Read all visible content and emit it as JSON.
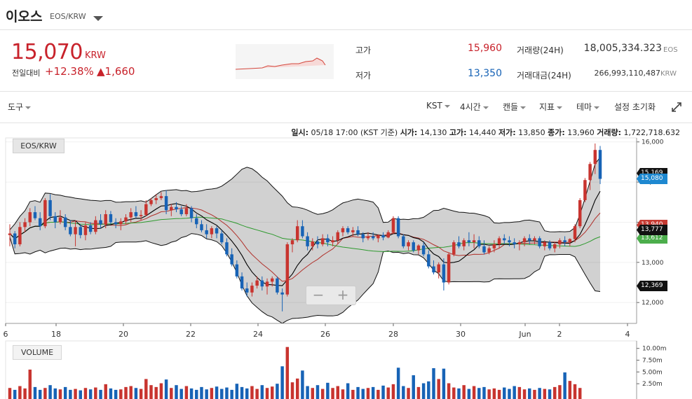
{
  "header": {
    "name": "이오스",
    "pair": "EOS/KRW"
  },
  "price": {
    "current": "15,070",
    "unit": "KRW",
    "change_label": "전일대비",
    "change_pct": "+12.38%",
    "change_amt": "▲1,660"
  },
  "stats": {
    "high_label": "고가",
    "high_value": "15,960",
    "low_label": "저가",
    "low_value": "13,350",
    "volume_label": "거래량(24H)",
    "volume_value": "18,005,334.323",
    "volume_unit": "EOS",
    "amount_label": "거래대금(24H)",
    "amount_value": "266,993,110,487",
    "amount_unit": "KRW"
  },
  "toolbar": {
    "tools": "도구",
    "timezone": "KST",
    "interval": "4시간",
    "chart_type": "캔들",
    "indicators": "지표",
    "theme": "테마",
    "reset": "설정 초기화"
  },
  "ohlc_info": {
    "date_label": "일시:",
    "date_value": "05/18 17:00 (KST 기준)",
    "open_label": "시가:",
    "open_value": "14,130",
    "high_label": "고가:",
    "high_value": "14,440",
    "low_label": "저가:",
    "low_value": "13,850",
    "close_label": "종가:",
    "close_value": "13,960",
    "volume_label": "거래량:",
    "volume_value": "1,722,718.632"
  },
  "chart_labels": {
    "pair_tag": "EOS/KRW",
    "volume_tag": "VOLUME",
    "zoom_out": "−",
    "zoom_in": "+"
  },
  "price_tags": {
    "current": "15,080",
    "upper_hidden": "15,169",
    "ma1": "13,940",
    "ma2": "13,777",
    "ma3": "13,612",
    "lower": "12,369"
  },
  "colors": {
    "up": "#c8342f",
    "down": "#1763b6",
    "ma_short": "#000000",
    "ma_mid": "#b0302a",
    "ma_long": "#2e9a2e",
    "band_fill": "#d1d1d1"
  },
  "chart_data": {
    "type": "candlestick",
    "x_ticks": [
      "6",
      "18",
      "20",
      "22",
      "24",
      "26",
      "28",
      "30",
      "Jun",
      "2",
      "4"
    ],
    "y_ticks": [
      "16,000",
      "15,000",
      "14,000",
      "13,000",
      "12,000"
    ],
    "y_range": [
      11480,
      16100
    ],
    "volume_ticks": [
      "10.00m",
      "7.50m",
      "5.00m",
      "2.50m"
    ],
    "volume_range": [
      0,
      10700000
    ],
    "candles": [
      [
        13680,
        13950,
        13400,
        13720
      ],
      [
        13720,
        13780,
        13350,
        13450
      ],
      [
        13450,
        14000,
        13400,
        13880
      ],
      [
        13880,
        14100,
        13750,
        14000
      ],
      [
        14000,
        14350,
        13900,
        14250
      ],
      [
        14250,
        14400,
        14050,
        14100
      ],
      [
        14100,
        14250,
        13800,
        13900
      ],
      [
        13900,
        14600,
        13850,
        14550
      ],
      [
        14550,
        14700,
        14050,
        14150
      ],
      [
        14150,
        14250,
        13850,
        14000
      ],
      [
        14000,
        14300,
        13950,
        14120
      ],
      [
        14120,
        14200,
        13800,
        13880
      ],
      [
        13880,
        14050,
        13650,
        13700
      ],
      [
        13700,
        14050,
        13400,
        13880
      ],
      [
        13880,
        13950,
        13600,
        13680
      ],
      [
        13680,
        14000,
        13550,
        13920
      ],
      [
        13920,
        14000,
        13700,
        13760
      ],
      [
        13760,
        14150,
        13700,
        14050
      ],
      [
        14050,
        14200,
        13850,
        13950
      ],
      [
        13950,
        14300,
        13850,
        14200
      ],
      [
        14200,
        14280,
        13950,
        14000
      ],
      [
        14000,
        14100,
        13850,
        13950
      ],
      [
        13950,
        14100,
        13800,
        14020
      ],
      [
        14020,
        14200,
        13950,
        14120
      ],
      [
        14120,
        14350,
        14000,
        14250
      ],
      [
        14250,
        14400,
        14100,
        14150
      ],
      [
        14150,
        14300,
        14050,
        14180
      ],
      [
        14180,
        14550,
        14150,
        14450
      ],
      [
        14450,
        14600,
        14400,
        14550
      ],
      [
        14550,
        14700,
        14450,
        14600
      ],
      [
        14600,
        14750,
        14550,
        14650
      ],
      [
        14650,
        14800,
        14200,
        14300
      ],
      [
        14300,
        14450,
        14150,
        14380
      ],
      [
        14380,
        14500,
        14250,
        14320
      ],
      [
        14320,
        14400,
        14150,
        14200
      ],
      [
        14200,
        14450,
        14150,
        14350
      ],
      [
        14350,
        14400,
        14000,
        14100
      ],
      [
        14100,
        14200,
        13850,
        13950
      ],
      [
        13950,
        14050,
        13750,
        13800
      ],
      [
        13800,
        13950,
        13600,
        13700
      ],
      [
        13700,
        13900,
        13600,
        13850
      ],
      [
        13850,
        13900,
        13600,
        13720
      ],
      [
        13720,
        13800,
        13450,
        13500
      ],
      [
        13500,
        13600,
        13150,
        13200
      ],
      [
        13200,
        13350,
        12900,
        12950
      ],
      [
        12950,
        13050,
        12600,
        12650
      ],
      [
        12650,
        12750,
        12300,
        12350
      ],
      [
        12350,
        12500,
        12150,
        12250
      ],
      [
        12250,
        12500,
        12150,
        12420
      ],
      [
        12420,
        12650,
        12350,
        12550
      ],
      [
        12550,
        12650,
        12300,
        12400
      ],
      [
        12400,
        12600,
        12200,
        12520
      ],
      [
        12520,
        12650,
        12400,
        12600
      ],
      [
        12600,
        12650,
        12200,
        12250
      ],
      [
        12250,
        12350,
        11780,
        12200
      ],
      [
        12200,
        13500,
        12150,
        13450
      ],
      [
        13450,
        13600,
        13250,
        13550
      ],
      [
        13550,
        14050,
        13500,
        13900
      ],
      [
        13900,
        14050,
        13600,
        13650
      ],
      [
        13650,
        13750,
        13300,
        13400
      ],
      [
        13400,
        13600,
        13300,
        13520
      ],
      [
        13520,
        13650,
        13350,
        13450
      ],
      [
        13450,
        13700,
        13400,
        13600
      ],
      [
        13600,
        13700,
        13400,
        13500
      ],
      [
        13500,
        13650,
        13400,
        13550
      ],
      [
        13550,
        13800,
        13450,
        13750
      ],
      [
        13750,
        13900,
        13650,
        13850
      ],
      [
        13850,
        13900,
        13700,
        13750
      ],
      [
        13750,
        13880,
        13650,
        13800
      ],
      [
        13800,
        13900,
        13650,
        13700
      ],
      [
        13700,
        13750,
        13500,
        13600
      ],
      [
        13600,
        13750,
        13550,
        13650
      ],
      [
        13650,
        13750,
        13550,
        13600
      ],
      [
        13600,
        13700,
        13500,
        13680
      ],
      [
        13680,
        13750,
        13550,
        13620
      ],
      [
        13620,
        13800,
        13600,
        13750
      ],
      [
        13750,
        14150,
        13700,
        14100
      ],
      [
        14100,
        14150,
        13600,
        13650
      ],
      [
        13650,
        13700,
        13350,
        13400
      ],
      [
        13400,
        13550,
        13300,
        13500
      ],
      [
        13500,
        13550,
        13250,
        13300
      ],
      [
        13300,
        13450,
        13200,
        13420
      ],
      [
        13420,
        13500,
        13150,
        13200
      ],
      [
        13200,
        13300,
        12850,
        12900
      ],
      [
        12900,
        13050,
        12700,
        12750
      ],
      [
        12750,
        13000,
        12600,
        12950
      ],
      [
        12950,
        13100,
        12300,
        12500
      ],
      [
        12500,
        13250,
        12450,
        13200
      ],
      [
        13200,
        13550,
        13150,
        13500
      ],
      [
        13500,
        13650,
        13350,
        13400
      ],
      [
        13400,
        13600,
        13300,
        13550
      ],
      [
        13550,
        13750,
        13400,
        13500
      ],
      [
        13500,
        13700,
        13350,
        13550
      ],
      [
        13550,
        13650,
        13350,
        13400
      ],
      [
        13400,
        13550,
        13200,
        13250
      ],
      [
        13250,
        13400,
        13200,
        13350
      ],
      [
        13350,
        13550,
        13250,
        13450
      ],
      [
        13450,
        13650,
        13350,
        13600
      ],
      [
        13600,
        13700,
        13450,
        13550
      ],
      [
        13550,
        13650,
        13400,
        13500
      ],
      [
        13500,
        13600,
        13350,
        13450
      ],
      [
        13450,
        13550,
        13300,
        13500
      ],
      [
        13500,
        13650,
        13400,
        13600
      ],
      [
        13600,
        13700,
        13450,
        13550
      ],
      [
        13550,
        13650,
        13450,
        13600
      ],
      [
        13600,
        13650,
        13350,
        13400
      ],
      [
        13400,
        13550,
        13300,
        13500
      ],
      [
        13500,
        13550,
        13300,
        13350
      ],
      [
        13350,
        13500,
        13250,
        13450
      ],
      [
        13450,
        13600,
        13350,
        13550
      ],
      [
        13550,
        13650,
        13400,
        13500
      ],
      [
        13500,
        13600,
        13400,
        13580
      ],
      [
        13580,
        13950,
        13500,
        13900
      ],
      [
        13900,
        14600,
        13850,
        14550
      ],
      [
        14550,
        15100,
        14500,
        15050
      ],
      [
        15050,
        15500,
        14800,
        15450
      ],
      [
        15450,
        15960,
        15200,
        15800
      ],
      [
        15800,
        15900,
        14950,
        15080
      ]
    ],
    "volumes": [
      1.6,
      1.2,
      2.0,
      1.5,
      5.5,
      1.8,
      1.2,
      1.6,
      2.2,
      1.5,
      1.3,
      1.8,
      1.2,
      1.4,
      1.1,
      1.6,
      1.3,
      1.7,
      1.2,
      2.4,
      1.5,
      1.2,
      1.3,
      1.8,
      2.0,
      1.6,
      1.4,
      3.5,
      2.2,
      1.8,
      2.6,
      3.4,
      1.6,
      2.2,
      1.4,
      2.0,
      1.5,
      1.2,
      1.8,
      1.3,
      1.6,
      1.9,
      1.4,
      1.7,
      1.2,
      2.5,
      1.8,
      1.5,
      2.0,
      1.4,
      2.2,
      1.6,
      1.9,
      2.5,
      6.2,
      10.3,
      2.8,
      3.6,
      5.3,
      2.0,
      1.6,
      2.2,
      1.4,
      2.7,
      1.6,
      2.0,
      1.3,
      2.6,
      1.2,
      1.8,
      1.4,
      1.6,
      1.8,
      1.2,
      2.1,
      1.7,
      2.4,
      5.9,
      2.0,
      1.6,
      4.3,
      1.8,
      2.6,
      3.0,
      5.8,
      3.5,
      5.7,
      2.6,
      1.7,
      1.5,
      2.2,
      1.4,
      2.0,
      1.6,
      1.8,
      1.3,
      1.5,
      1.2,
      1.7,
      1.4,
      2.0,
      1.8,
      1.3,
      1.5,
      1.2,
      1.6,
      1.4,
      1.3,
      1.8,
      2.2,
      4.9,
      3.1,
      2.4,
      1.6
    ],
    "volume_unit": "m"
  }
}
